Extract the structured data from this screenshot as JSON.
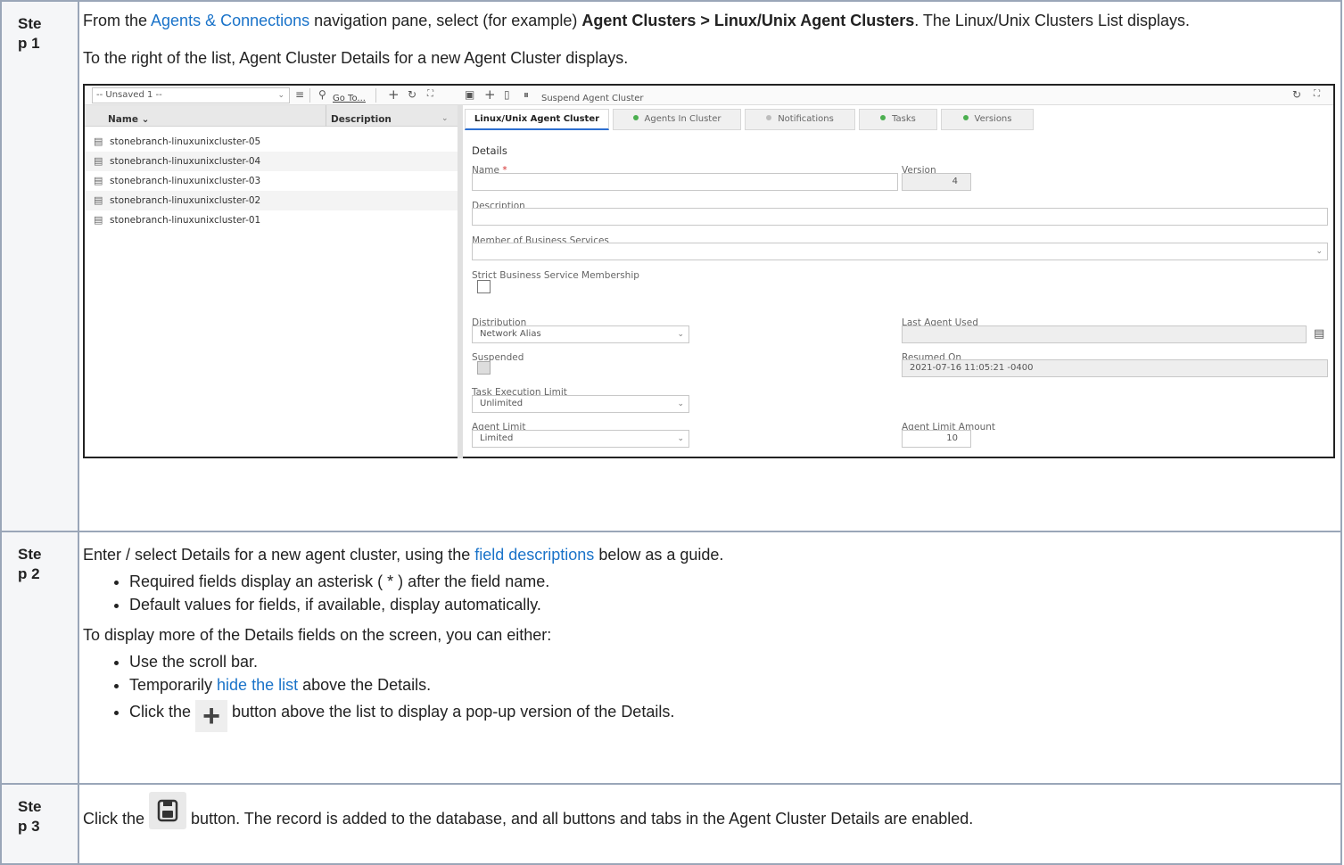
{
  "steps": [
    {
      "label_line1": "Ste",
      "label_line2": "p 1",
      "p1_pre": "From the ",
      "p1_link": "Agents & Connections",
      "p1_mid": " navigation pane, select (for example) ",
      "p1_bold": "Agent Clusters > Linux/Unix Agent Clusters",
      "p1_post": ". The Linux/Unix Clusters List displays.",
      "p2": "To the right of the list, Agent Cluster Details for a new Agent Cluster displays."
    },
    {
      "label_line1": "Ste",
      "label_line2": "p 2",
      "p1_pre": "Enter / select Details for a new agent cluster, using the ",
      "p1_link": "field descriptions",
      "p1_post": " below as a guide.",
      "bullets1": [
        "Required fields display an asterisk ( * ) after the field name.",
        "Default values for fields, if available, display automatically."
      ],
      "p2": "To display more of the Details fields on the screen, you can either:",
      "b2_1": "Use the scroll bar.",
      "b2_2_pre": "Temporarily ",
      "b2_2_link": "hide the list",
      "b2_2_post": " above the Details.",
      "b2_3_pre": "Click the ",
      "b2_3_post": " button above the list to display a pop-up version of the Details."
    },
    {
      "label_line1": "Ste",
      "label_line2": "p 3",
      "pre": "Click the ",
      "post": " button. The record is added to the database, and all buttons and tabs in the Agent Cluster Details are enabled."
    }
  ],
  "screenshot": {
    "toolbar": {
      "filter_value": "-- Unsaved 1 --",
      "goto_label": "Go To...",
      "suspend_label": "Suspend Agent Cluster"
    },
    "list": {
      "col_name": "Name",
      "col_description": "Description",
      "rows": [
        "stonebranch-linuxunixcluster-05",
        "stonebranch-linuxunixcluster-04",
        "stonebranch-linuxunixcluster-03",
        "stonebranch-linuxunixcluster-02",
        "stonebranch-linuxunixcluster-01"
      ]
    },
    "tabs": [
      "Linux/Unix Agent Cluster",
      "Agents In Cluster",
      "Notifications",
      "Tasks",
      "Versions"
    ],
    "form": {
      "section": "Details",
      "name_label": "Name",
      "required_mark": "*",
      "version_label": "Version",
      "version_value": "4",
      "description_label": "Description",
      "member_label": "Member of Business Services",
      "strict_label": "Strict Business Service Membership",
      "distribution_label": "Distribution",
      "distribution_value": "Network Alias",
      "last_agent_label": "Last Agent Used",
      "suspended_label": "Suspended",
      "resumed_label": "Resumed On",
      "resumed_value": "2021-07-16 11:05:21 -0400",
      "task_limit_label": "Task Execution Limit",
      "task_limit_value": "Unlimited",
      "agent_limit_label": "Agent Limit",
      "agent_limit_value": "Limited",
      "agent_limit_amount_label": "Agent Limit Amount",
      "agent_limit_amount_value": "10"
    },
    "colors": {
      "link": "#1a73c9",
      "active_tab": "#2c6fd1",
      "dot_green": "#4caf50",
      "dot_gray": "#bdbdbd",
      "required": "#d32f2f"
    }
  }
}
